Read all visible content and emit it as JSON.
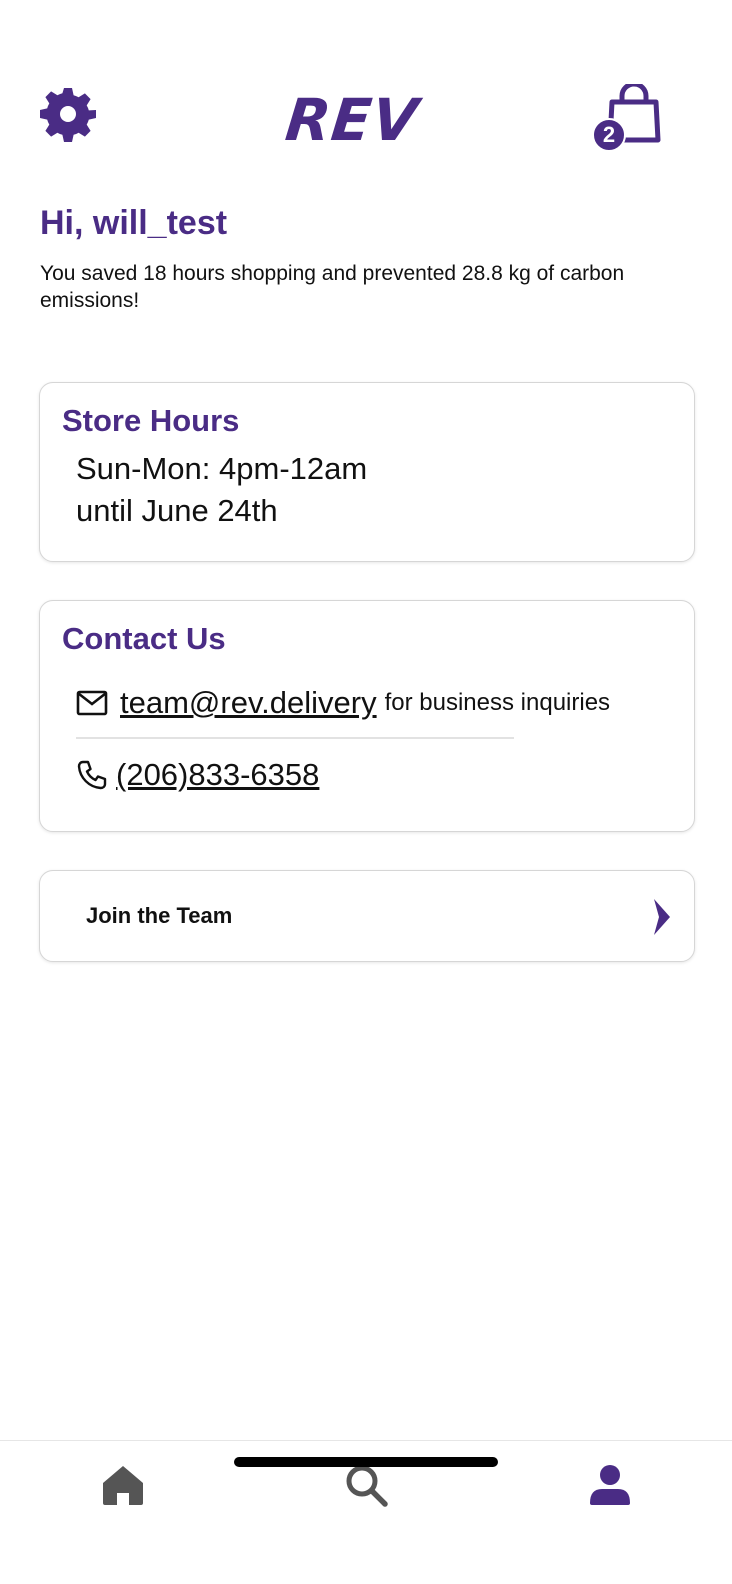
{
  "app": {
    "logo_text": "REV",
    "brand_color": "#4a2c85"
  },
  "header": {
    "settings_icon": "gear-icon",
    "cart_icon": "shopping-bag-icon",
    "cart_count": "2"
  },
  "greeting": {
    "title": "Hi, will_test",
    "savings_message": "You saved 18 hours shopping and prevented 28.8 kg of carbon emissions!"
  },
  "store_hours": {
    "title": "Store Hours",
    "line1": "Sun-Mon: 4pm-12am",
    "line2": "until June 24th"
  },
  "contact": {
    "title": "Contact Us",
    "email": "team@rev.delivery",
    "email_note": "for business inquiries",
    "phone": "(206)833-6358",
    "email_icon": "mail-icon",
    "phone_icon": "phone-icon"
  },
  "join": {
    "label": "Join the Team",
    "icon": "chevron-right-icon"
  },
  "tabbar": {
    "tabs": [
      {
        "name": "home",
        "icon": "home-icon",
        "active": false
      },
      {
        "name": "search",
        "icon": "search-icon",
        "active": false
      },
      {
        "name": "profile",
        "icon": "profile-icon",
        "active": true
      }
    ],
    "inactive_color": "#555555",
    "active_color": "#4a2c85"
  }
}
